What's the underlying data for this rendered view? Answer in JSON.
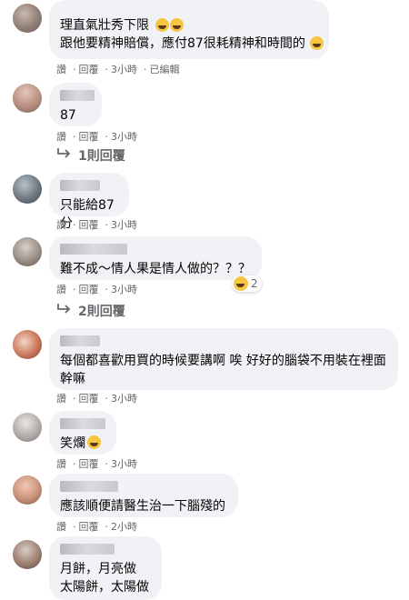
{
  "actions": {
    "like": "讚",
    "reply": "回覆",
    "dot": "·",
    "edited": "已編輯"
  },
  "comments": [
    {
      "text": "理直氣壯秀下限\n跟他要精神賠償，應付87很耗精神和時間的",
      "time": "3小時",
      "edited": true
    },
    {
      "text": "87",
      "time": "3小時",
      "replies_label": "1則回覆"
    },
    {
      "text": "只能給87分",
      "time": "3小時"
    },
    {
      "text": "難不成～情人果是情人做的？？？",
      "time": "3小時",
      "reaction": {
        "icon": "laughing-emoji-icon",
        "count": "2"
      },
      "replies_label": "2則回覆"
    },
    {
      "text": "每個都喜歡用買的時候要講啊 唉 好好的腦袋不用裝在裡面幹嘛",
      "time": "3小時"
    },
    {
      "text": "笑爛",
      "time": "3小時"
    },
    {
      "text": "應該順便請醫生治一下腦殘的",
      "time": "2小時"
    },
    {
      "text": "月餅，月亮做\n太陽餅，太陽做"
    }
  ]
}
